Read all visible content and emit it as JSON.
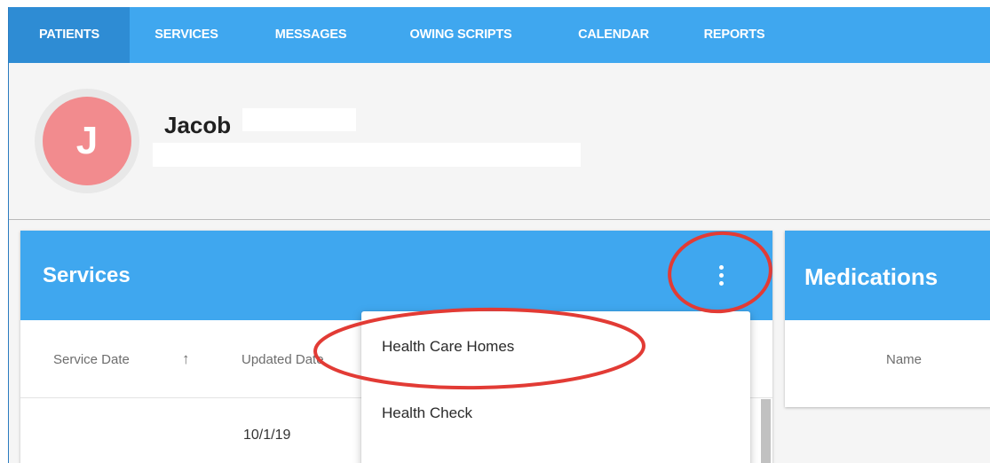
{
  "nav": {
    "tabs": [
      {
        "label": "PATIENTS"
      },
      {
        "label": "SERVICES"
      },
      {
        "label": "MESSAGES"
      },
      {
        "label": "OWING SCRIPTS"
      },
      {
        "label": "CALENDAR"
      },
      {
        "label": "REPORTS"
      }
    ],
    "active_tab": "PATIENTS"
  },
  "patient": {
    "initial": "J",
    "name": "Jacob"
  },
  "services_card": {
    "title": "Services",
    "columns": [
      "Service Date",
      "Updated Date"
    ],
    "sort_icon": "arrow-up-icon",
    "rows": [
      {
        "service_date": "",
        "updated_date": "10/1/19"
      }
    ]
  },
  "dropdown_menu": {
    "items": [
      "Health Care Homes",
      "Health Check"
    ]
  },
  "medications_card": {
    "title": "Medications",
    "columns": [
      "Name"
    ]
  },
  "colors": {
    "primary": "#3fa7ef",
    "nav_active": "#2e8cd4",
    "avatar": "#f28b8e",
    "annotation": "#e23b35"
  }
}
